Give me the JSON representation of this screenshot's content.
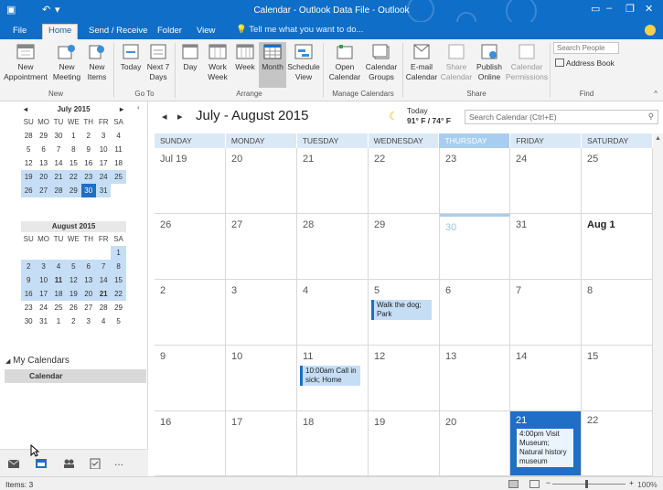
{
  "window": {
    "title": "Calendar - Outlook Data File - Outlook"
  },
  "tabs": [
    "File",
    "Home",
    "Send / Receive",
    "Folder",
    "View"
  ],
  "tell_me": "Tell me what you want to do...",
  "ribbon": {
    "groups": {
      "new": "New",
      "goto": "Go To",
      "arrange": "Arrange",
      "manage": "Manage Calendars",
      "share": "Share",
      "find": "Find"
    },
    "buttons": {
      "new_appointment": "New Appointment",
      "new_meeting": "New Meeting",
      "new_items": "New Items",
      "today": "Today",
      "next7": "Next 7 Days",
      "day": "Day",
      "work_week": "Work Week",
      "week": "Week",
      "month": "Month",
      "schedule_view": "Schedule View",
      "open_calendar": "Open Calendar",
      "calendar_groups": "Calendar Groups",
      "email_calendar": "E-mail Calendar",
      "share_calendar": "Share Calendar",
      "publish_online": "Publish Online",
      "calendar_permissions": "Calendar Permissions"
    },
    "search_people_placeholder": "Search People",
    "address_book": "Address Book"
  },
  "mini_calendars": [
    {
      "title": "July 2015",
      "weeks": [
        [
          "28",
          "29",
          "30",
          "1",
          "2",
          "3",
          "4"
        ],
        [
          "5",
          "6",
          "7",
          "8",
          "9",
          "10",
          "11"
        ],
        [
          "12",
          "13",
          "14",
          "15",
          "16",
          "17",
          "18"
        ],
        [
          "19",
          "20",
          "21",
          "22",
          "23",
          "24",
          "25"
        ],
        [
          "26",
          "27",
          "28",
          "29",
          "30",
          "31",
          ""
        ]
      ]
    },
    {
      "title": "August 2015",
      "weeks": [
        [
          "",
          "",
          "",
          "",
          "",
          "",
          "1"
        ],
        [
          "2",
          "3",
          "4",
          "5",
          "6",
          "7",
          "8"
        ],
        [
          "9",
          "10",
          "11",
          "12",
          "13",
          "14",
          "15"
        ],
        [
          "16",
          "17",
          "18",
          "19",
          "20",
          "21",
          "22"
        ],
        [
          "23",
          "24",
          "25",
          "26",
          "27",
          "28",
          "29"
        ],
        [
          "30",
          "31",
          "1",
          "2",
          "3",
          "4",
          "5"
        ]
      ]
    }
  ],
  "day_initials": [
    "SU",
    "MO",
    "TU",
    "WE",
    "TH",
    "FR",
    "SA"
  ],
  "nav": {
    "my_calendars": "My Calendars",
    "calendar": "Calendar",
    "more": "..."
  },
  "calendar": {
    "title": "July - August 2015",
    "weather_label": "Today",
    "weather_temp": "91° F / 74° F",
    "search_placeholder": "Search Calendar (Ctrl+E)",
    "dow": [
      "SUNDAY",
      "MONDAY",
      "TUESDAY",
      "WEDNESDAY",
      "THURSDAY",
      "FRIDAY",
      "SATURDAY"
    ],
    "weeks": [
      [
        "Jul 19",
        "20",
        "21",
        "22",
        "23",
        "24",
        "25"
      ],
      [
        "26",
        "27",
        "28",
        "29",
        "30",
        "31",
        "Aug 1"
      ],
      [
        "2",
        "3",
        "4",
        "5",
        "6",
        "7",
        "8"
      ],
      [
        "9",
        "10",
        "11",
        "12",
        "13",
        "14",
        "15"
      ],
      [
        "16",
        "17",
        "18",
        "19",
        "20",
        "21",
        "22"
      ]
    ],
    "appointments": {
      "walk_dog": "Walk the dog; Park",
      "call_sick": "10:00am Call in sick; Home",
      "museum": "4:00pm Visit Museum; Natural history museum"
    }
  },
  "status": {
    "items": "Items: 3",
    "zoom": "100%"
  },
  "colors": {
    "accent": "#0f6ec7",
    "selected": "#1e6fc5",
    "highlight": "#c5def5"
  }
}
